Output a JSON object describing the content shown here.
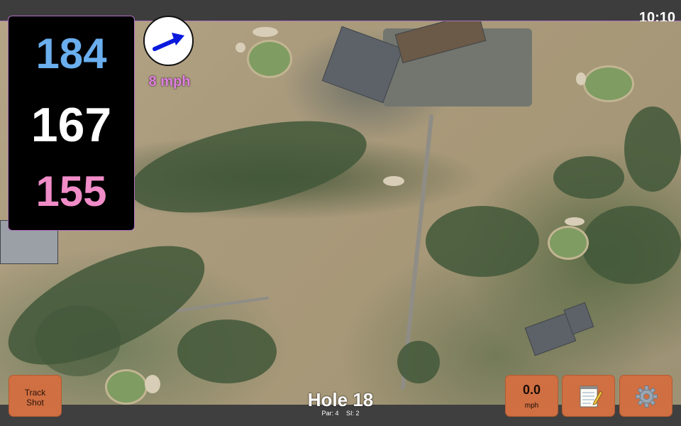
{
  "status_bar": {
    "time": "10:10"
  },
  "distances": {
    "back": "184",
    "middle": "167",
    "front": "155"
  },
  "wind": {
    "speed_label": "8 mph",
    "direction_icon": "arrow-up-right-icon"
  },
  "hole": {
    "title": "Hole 18",
    "par_label": "Par: 4",
    "si_label": "SI: 2"
  },
  "buttons": {
    "track_shot_line1": "Track",
    "track_shot_line2": "Shot",
    "speed_value": "0.0",
    "speed_unit": "mph",
    "notes_icon": "notepad-icon",
    "settings_icon": "gear-icon"
  },
  "colors": {
    "back_distance": "#6aaeee",
    "middle_distance": "#ffffff",
    "front_distance": "#f08cc8",
    "button_bg": "#cf6f42",
    "wind_text": "#e07fe0"
  }
}
